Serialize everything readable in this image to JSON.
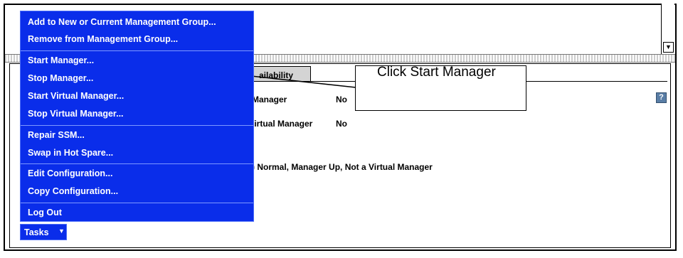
{
  "menu": {
    "items": [
      {
        "label": "Add to New or Current Management Group..."
      },
      {
        "label": "Remove from Management Group..."
      },
      {
        "label": "Start Manager..."
      },
      {
        "label": "Stop Manager..."
      },
      {
        "label": "Start Virtual Manager..."
      },
      {
        "label": "Stop Virtual Manager..."
      },
      {
        "label": "Repair SSM..."
      },
      {
        "label": "Swap in Hot Spare..."
      },
      {
        "label": "Edit Configuration..."
      },
      {
        "label": "Copy Configuration..."
      },
      {
        "label": "Log Out"
      }
    ]
  },
  "tasks_button": {
    "label": "Tasks",
    "icon": "chevron-down-icon"
  },
  "tab": {
    "label": "ailability"
  },
  "fields": {
    "manager_label": "Manager",
    "manager_value": "No",
    "virtual_manager_label": "/irtual Manager",
    "virtual_manager_value": "No",
    "status_text": ") Normal, Manager Up, Not a Virtual Manager"
  },
  "help_icon": {
    "glyph": "?",
    "icon": "help-icon"
  },
  "callout": {
    "text": "Click Start Manager"
  },
  "scrollbar": {
    "down_glyph": "▼"
  },
  "colors": {
    "menu_bg": "#0a2dea",
    "menu_text": "#ffffff",
    "help_icon": "#5a7ea6"
  }
}
